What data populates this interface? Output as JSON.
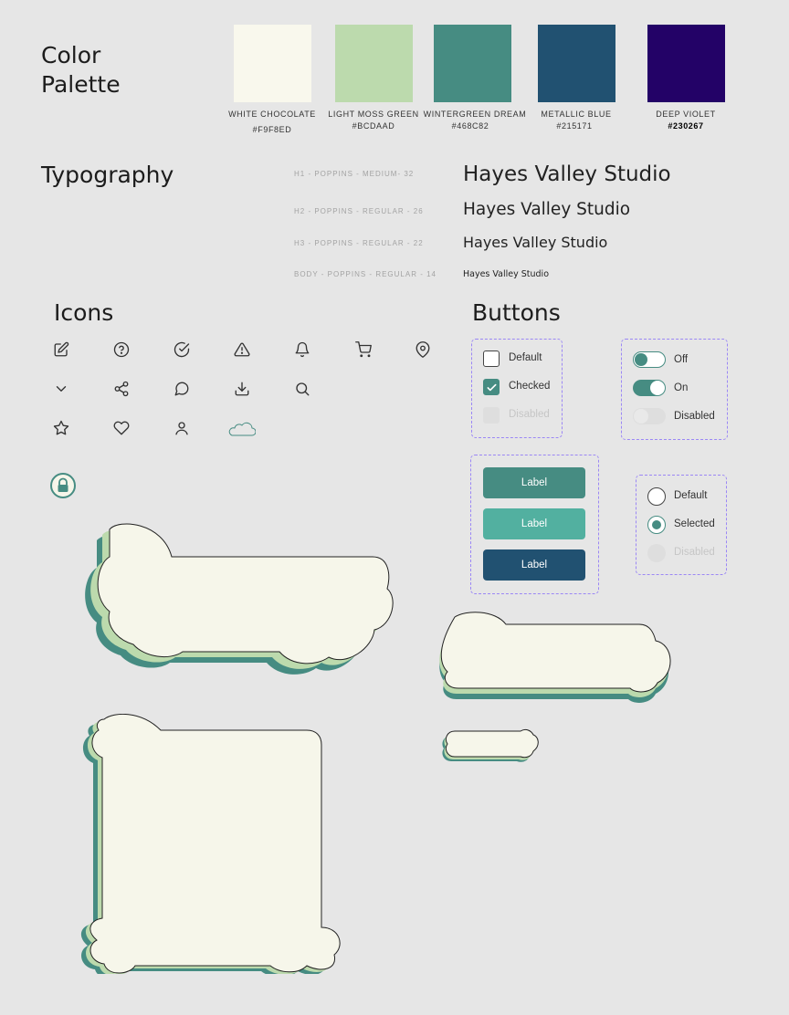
{
  "palette": {
    "title_line1": "Color",
    "title_line2": "Palette",
    "swatches": [
      {
        "name": "WHITE CHOCOLATE",
        "hex": "#F9F8ED",
        "color": "#F9F8ED"
      },
      {
        "name": "LIGHT MOSS GREEN",
        "hex": "#BCDAAD",
        "color": "#BCDAAD"
      },
      {
        "name": "WINTERGREEN DREAM",
        "hex": "#468C82",
        "color": "#468C82"
      },
      {
        "name": "METALLIC BLUE",
        "hex": "#215171",
        "color": "#215171"
      },
      {
        "name": "DEEP VIOLET",
        "hex": "#230267",
        "color": "#230267"
      }
    ]
  },
  "typography": {
    "title": "Typography",
    "styles": [
      {
        "label": "H1 - POPPINS - MEDIUM- 32",
        "sample": "Hayes Valley Studio"
      },
      {
        "label": "H2 - POPPINS - REGULAR - 26",
        "sample": "Hayes Valley Studio"
      },
      {
        "label": "H3 - POPPINS - REGULAR - 22",
        "sample": "Hayes Valley Studio"
      },
      {
        "label": "BODY - POPPINS - REGULAR - 14",
        "sample": "Hayes Valley Studio"
      }
    ]
  },
  "icons": {
    "title": "Icons",
    "names": [
      "edit-icon",
      "help-icon",
      "check-circle-icon",
      "warning-icon",
      "bell-icon",
      "cart-icon",
      "location-pin-icon",
      "chevron-down-icon",
      "share-icon",
      "chat-icon",
      "download-icon",
      "search-icon",
      "star-icon",
      "heart-icon",
      "user-icon",
      "cloud-icon",
      "lock-badge-icon"
    ]
  },
  "buttons": {
    "title": "Buttons",
    "checkboxes": {
      "default": "Default",
      "checked": "Checked",
      "disabled": "Disabled"
    },
    "toggles": {
      "off": "Off",
      "on": "On",
      "disabled": "Disabled"
    },
    "actions": [
      {
        "label": "Label",
        "color": "#468C82"
      },
      {
        "label": "Label",
        "color": "#52B0A0"
      },
      {
        "label": "Label",
        "color": "#215171"
      }
    ],
    "radios": {
      "default": "Default",
      "selected": "Selected",
      "disabled": "Disabled"
    }
  },
  "colors": {
    "accent": "#468C82",
    "moss": "#BCDAAD",
    "cream": "#F6F6EA",
    "outline_dashed": "#9B87F5"
  }
}
